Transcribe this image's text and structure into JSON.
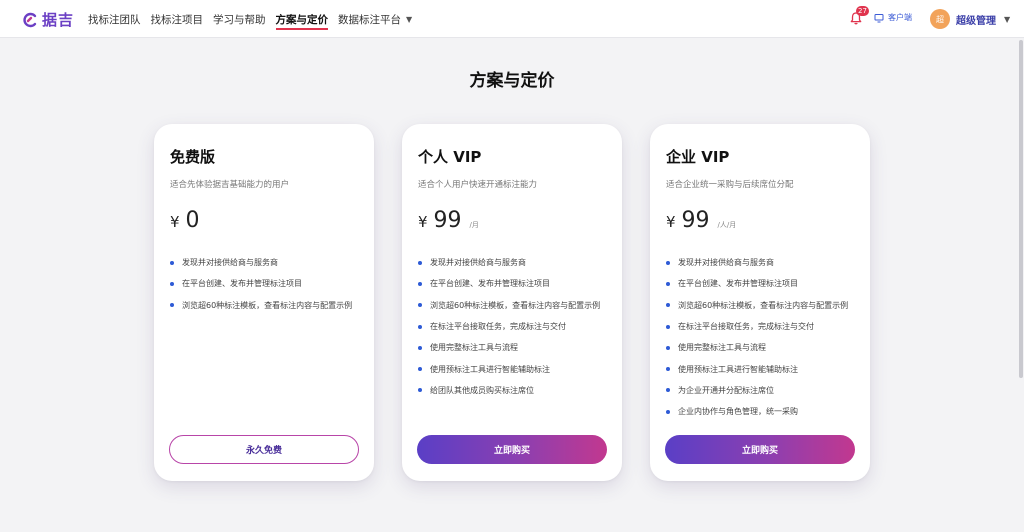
{
  "header": {
    "logo_text": "据吉",
    "nav": [
      {
        "label": "找标注团队",
        "active": false
      },
      {
        "label": "找标注项目",
        "active": false
      },
      {
        "label": "学习与帮助",
        "active": false
      },
      {
        "label": "方案与定价",
        "active": true
      },
      {
        "label": "数据标注平台",
        "active": false,
        "has_dropdown": true
      }
    ],
    "notification_count": "27",
    "client_label": "客户端",
    "user": {
      "avatar_text": "超",
      "name": "超级管理"
    }
  },
  "page": {
    "title": "方案与定价"
  },
  "plans": [
    {
      "title": "免费版",
      "desc": "适合先体验据吉基础能力的用户",
      "currency": "¥",
      "price": "0",
      "unit": "",
      "features": [
        "发现并对接供给商与服务商",
        "在平台创建、发布并管理标注项目",
        "浏览超60种标注模板，查看标注内容与配置示例"
      ],
      "button": "永久免费",
      "button_style": "outline"
    },
    {
      "title": "个人 VIP",
      "desc": "适合个人用户快速开通标注能力",
      "currency": "¥",
      "price": "99",
      "unit": "/月",
      "features": [
        "发现并对接供给商与服务商",
        "在平台创建、发布并管理标注项目",
        "浏览超60种标注模板，查看标注内容与配置示例",
        "在标注平台接取任务，完成标注与交付",
        "使用完整标注工具与流程",
        "使用预标注工具进行智能辅助标注",
        "给团队其他成员购买标注席位"
      ],
      "button": "立即购买",
      "button_style": "gradient"
    },
    {
      "title": "企业 VIP",
      "desc": "适合企业统一采购与后续席位分配",
      "currency": "¥",
      "price": "99",
      "unit": "/人/月",
      "features": [
        "发现并对接供给商与服务商",
        "在平台创建、发布并管理标注项目",
        "浏览超60种标注模板，查看标注内容与配置示例",
        "在标注平台接取任务，完成标注与交付",
        "使用完整标注工具与流程",
        "使用预标注工具进行智能辅助标注",
        "为企业开通并分配标注席位",
        "企业内协作与角色管理，统一采购"
      ],
      "button": "立即购买",
      "button_style": "gradient"
    }
  ],
  "colors": {
    "brand": "#6b3fc4",
    "accent_underline": "#e0344e",
    "bullet": "#2e5bd6",
    "gradient_start": "#5a3fc6",
    "gradient_end": "#c2388f"
  }
}
